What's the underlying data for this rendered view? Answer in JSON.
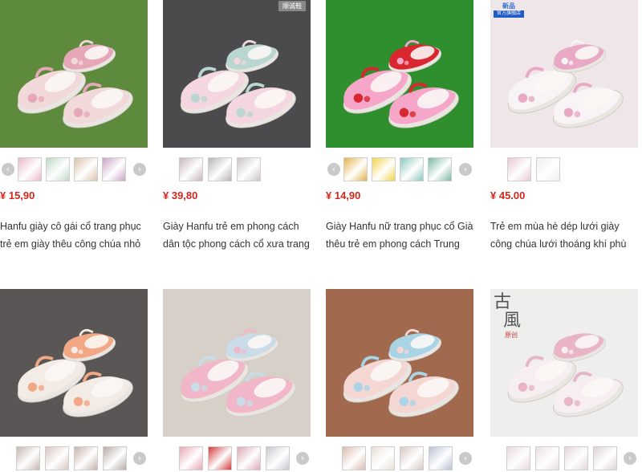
{
  "currency_symbol": "¥",
  "products": [
    {
      "price": "¥ 15,90",
      "title_line1": "Hanfu giày cô gái cổ trang phục",
      "title_line2": "trẻ em giày thêu công chúa nhỏ",
      "bg": "#5d8a3c",
      "shoe": "#f1d9d9",
      "accent": "#e6a8b8",
      "thumb_colors": [
        "#e9b9c6",
        "#bcd7c5",
        "#d9c2a8",
        "#c9a6c6"
      ]
    },
    {
      "price": "¥ 39,80",
      "title_line1": "Giày Hanfu trẻ em phong cách",
      "title_line2": "dân tộc phong cách cổ xưa trang",
      "bg": "#4b4b4e",
      "shoe": "#f3d6e0",
      "accent": "#b9d7d0",
      "thumb_colors": [
        "#c7b4bf",
        "#b9b2b8",
        "#c8c2c8"
      ]
    },
    {
      "price": "¥ 14,90",
      "title_line1": "Giày Hanfu nữ trang phục cổ Giày",
      "title_line2": "thêu trẻ em phong cách Trung",
      "bg": "#2f8f2f",
      "shoe": "#f6a6c8",
      "accent": "#d9272f",
      "thumb_colors": [
        "#e3b34b",
        "#f0d34a",
        "#8cc8c0",
        "#7db8a4"
      ]
    },
    {
      "price": "¥ 45.00",
      "title_line1": "Trẻ em mùa hè dép lưới giày",
      "title_line2": "công chúa lưới thoáng khí phù",
      "bg": "#efe6ea",
      "shoe": "#f8f3f5",
      "accent": "#e9a9c4",
      "thumb_colors": [
        "#e8c8d4",
        "#f1eef0"
      ]
    },
    {
      "bg": "#5a5656",
      "shoe": "#f3ece6",
      "accent": "#f2a884",
      "thumb_colors": [
        "#c6b6b0",
        "#d9c6c0",
        "#c8b2ac",
        "#b8aaa6"
      ]
    },
    {
      "bg": "#d7d0c8",
      "shoe": "#f1b6c7",
      "accent": "#c9dce8",
      "thumb_colors": [
        "#e5a7b5",
        "#d23a3a",
        "#d9a9b3",
        "#c9c6cf"
      ]
    },
    {
      "bg": "#a16a4e",
      "shoe": "#f4d7d3",
      "accent": "#a9d4e6",
      "thumb_colors": [
        "#d8b9ae",
        "#e8e0d8",
        "#d8c8c2",
        "#b9c2d4"
      ]
    },
    {
      "bg": "#eeeeed",
      "shoe": "#f6eef0",
      "accent": "#e8b4c6",
      "thumb_colors": [
        "#e6d8dc",
        "#eadfe2",
        "#e1d6d9",
        "#ddd3d6"
      ]
    }
  ],
  "badge_text_top": "新品",
  "badge_text_bottom": "官方旗舰店",
  "overlay_badge_text": "顺诚鞋",
  "brand_text_chinese_1": "古",
  "brand_text_chinese_2": "風",
  "brand_text_chinese_3": "原创"
}
